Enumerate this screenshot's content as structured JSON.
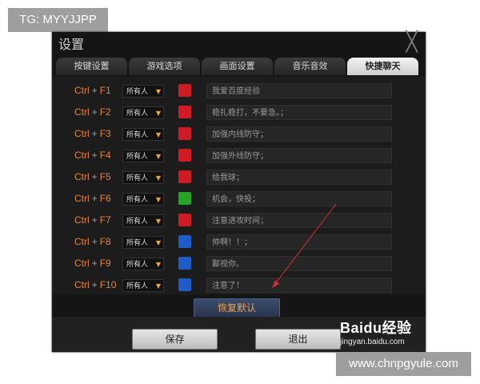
{
  "watermark_top": "TG: MYYJJPP",
  "watermark_bottom": "www.chnpgyule.com",
  "dialog": {
    "title": "设置",
    "close_symbol": "╳"
  },
  "tabs": [
    {
      "label": "按键设置"
    },
    {
      "label": "游戏选项"
    },
    {
      "label": "画面设置"
    },
    {
      "label": "音乐音效"
    },
    {
      "label": "快捷聊天"
    }
  ],
  "rows": [
    {
      "modifier": "Ctrl",
      "plus": "+",
      "key": "F1",
      "who": "所有人",
      "who_arrow": "▼",
      "icon": "red-icon",
      "message": "我爱百度经验"
    },
    {
      "modifier": "Ctrl",
      "plus": "+",
      "key": "F2",
      "who": "所有人",
      "who_arrow": "▼",
      "icon": "red-icon",
      "message": "稳扎稳打，不要急。；"
    },
    {
      "modifier": "Ctrl",
      "plus": "+",
      "key": "F3",
      "who": "所有人",
      "who_arrow": "▼",
      "icon": "red-icon",
      "message": "加强内线防守；"
    },
    {
      "modifier": "Ctrl",
      "plus": "+",
      "key": "F4",
      "who": "所有人",
      "who_arrow": "▼",
      "icon": "red-icon",
      "message": "加强外线防守；"
    },
    {
      "modifier": "Ctrl",
      "plus": "+",
      "key": "F5",
      "who": "所有人",
      "who_arrow": "▼",
      "icon": "red-icon",
      "message": "给我球；"
    },
    {
      "modifier": "Ctrl",
      "plus": "+",
      "key": "F6",
      "who": "所有人",
      "who_arrow": "▼",
      "icon": "green-lock-icon",
      "message": "机会，快投；"
    },
    {
      "modifier": "Ctrl",
      "plus": "+",
      "key": "F7",
      "who": "所有人",
      "who_arrow": "▼",
      "icon": "red-icon",
      "message": "注意进攻时间；"
    },
    {
      "modifier": "Ctrl",
      "plus": "+",
      "key": "F8",
      "who": "所有人",
      "who_arrow": "▼",
      "icon": "blue-thumb-icon",
      "message": "帅啊！！；"
    },
    {
      "modifier": "Ctrl",
      "plus": "+",
      "key": "F9",
      "who": "所有人",
      "who_arrow": "▼",
      "icon": "blue-icon",
      "message": "鄙视你。"
    },
    {
      "modifier": "Ctrl",
      "plus": "+",
      "key": "F10",
      "who": "所有人",
      "who_arrow": "▼",
      "icon": "blue-icon",
      "message": "注意了！"
    }
  ],
  "buttons": {
    "restore": "恢复默认",
    "save": "保存",
    "exit": "退出"
  },
  "logo": {
    "brand": "Baidu经验",
    "site": "jingyan.baidu.com"
  }
}
